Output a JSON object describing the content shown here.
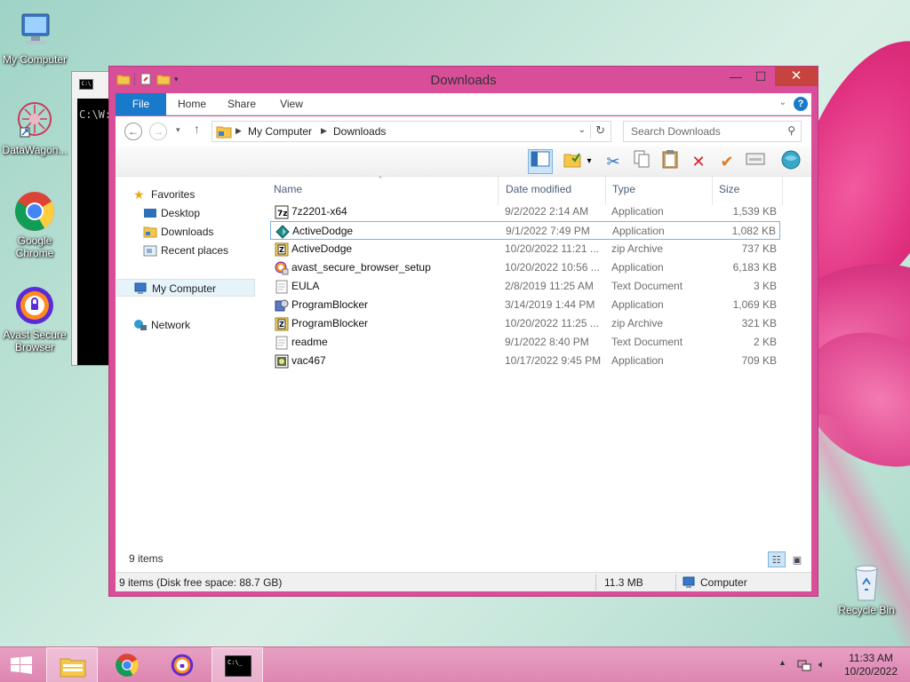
{
  "desktop": {
    "icons": [
      {
        "label": "My Computer"
      },
      {
        "label": "DataWagon..."
      },
      {
        "label": "Google Chrome"
      },
      {
        "label": "Avast Secure Browser"
      },
      {
        "label": "Recycle Bin"
      }
    ]
  },
  "console": {
    "text": "C:\\W:"
  },
  "window": {
    "title": "Downloads",
    "close_glyph": "✕",
    "maximize_glyph": "☐",
    "minimize_glyph": "—"
  },
  "ribbon": {
    "tabs": [
      "File",
      "Home",
      "Share",
      "View"
    ],
    "help": "?"
  },
  "address": {
    "crumbs": [
      "My Computer",
      "Downloads"
    ],
    "search_placeholder": "Search Downloads"
  },
  "nav": {
    "favorites": "Favorites",
    "desktop": "Desktop",
    "downloads": "Downloads",
    "recent": "Recent places",
    "my_computer": "My Computer",
    "network": "Network"
  },
  "columns": {
    "name": "Name",
    "date": "Date modified",
    "type": "Type",
    "size": "Size"
  },
  "files": [
    {
      "name": "7z2201-x64",
      "date": "9/2/2022 2:14 AM",
      "type": "Application",
      "size": "1,539 KB"
    },
    {
      "name": "ActiveDodge",
      "date": "9/1/2022 7:49 PM",
      "type": "Application",
      "size": "1,082 KB"
    },
    {
      "name": "ActiveDodge",
      "date": "10/20/2022 11:21 ...",
      "type": "zip Archive",
      "size": "737 KB"
    },
    {
      "name": "avast_secure_browser_setup",
      "date": "10/20/2022 10:56 ...",
      "type": "Application",
      "size": "6,183 KB"
    },
    {
      "name": "EULA",
      "date": "2/8/2019 11:25 AM",
      "type": "Text Document",
      "size": "3 KB"
    },
    {
      "name": "ProgramBlocker",
      "date": "3/14/2019 1:44 PM",
      "type": "Application",
      "size": "1,069 KB"
    },
    {
      "name": "ProgramBlocker",
      "date": "10/20/2022 11:25 ...",
      "type": "zip Archive",
      "size": "321 KB"
    },
    {
      "name": "readme",
      "date": "9/1/2022 8:40 PM",
      "type": "Text Document",
      "size": "2 KB"
    },
    {
      "name": "vac467",
      "date": "10/17/2022 9:45 PM",
      "type": "Application",
      "size": "709 KB"
    }
  ],
  "status": {
    "item_count": "9 items",
    "summary": "9 items (Disk free space: 88.7 GB)",
    "size": "11.3 MB",
    "location": "Computer"
  },
  "taskbar": {
    "time": "11:33 AM",
    "date": "10/20/2022"
  }
}
